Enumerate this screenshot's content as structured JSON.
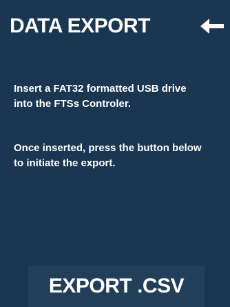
{
  "header": {
    "title": "DATA EXPORT",
    "back_icon": "left-arrow-icon"
  },
  "instructions": {
    "paragraph_1": "Insert a FAT32 formatted USB drive\ninto the FTSs Controler.",
    "paragraph_2": "Once inserted, press the button below\nto initiate the export."
  },
  "actions": {
    "export_label": "EXPORT .CSV"
  },
  "colors": {
    "background": "#1a3650",
    "button_background": "#223f59",
    "text": "#ffffff"
  }
}
